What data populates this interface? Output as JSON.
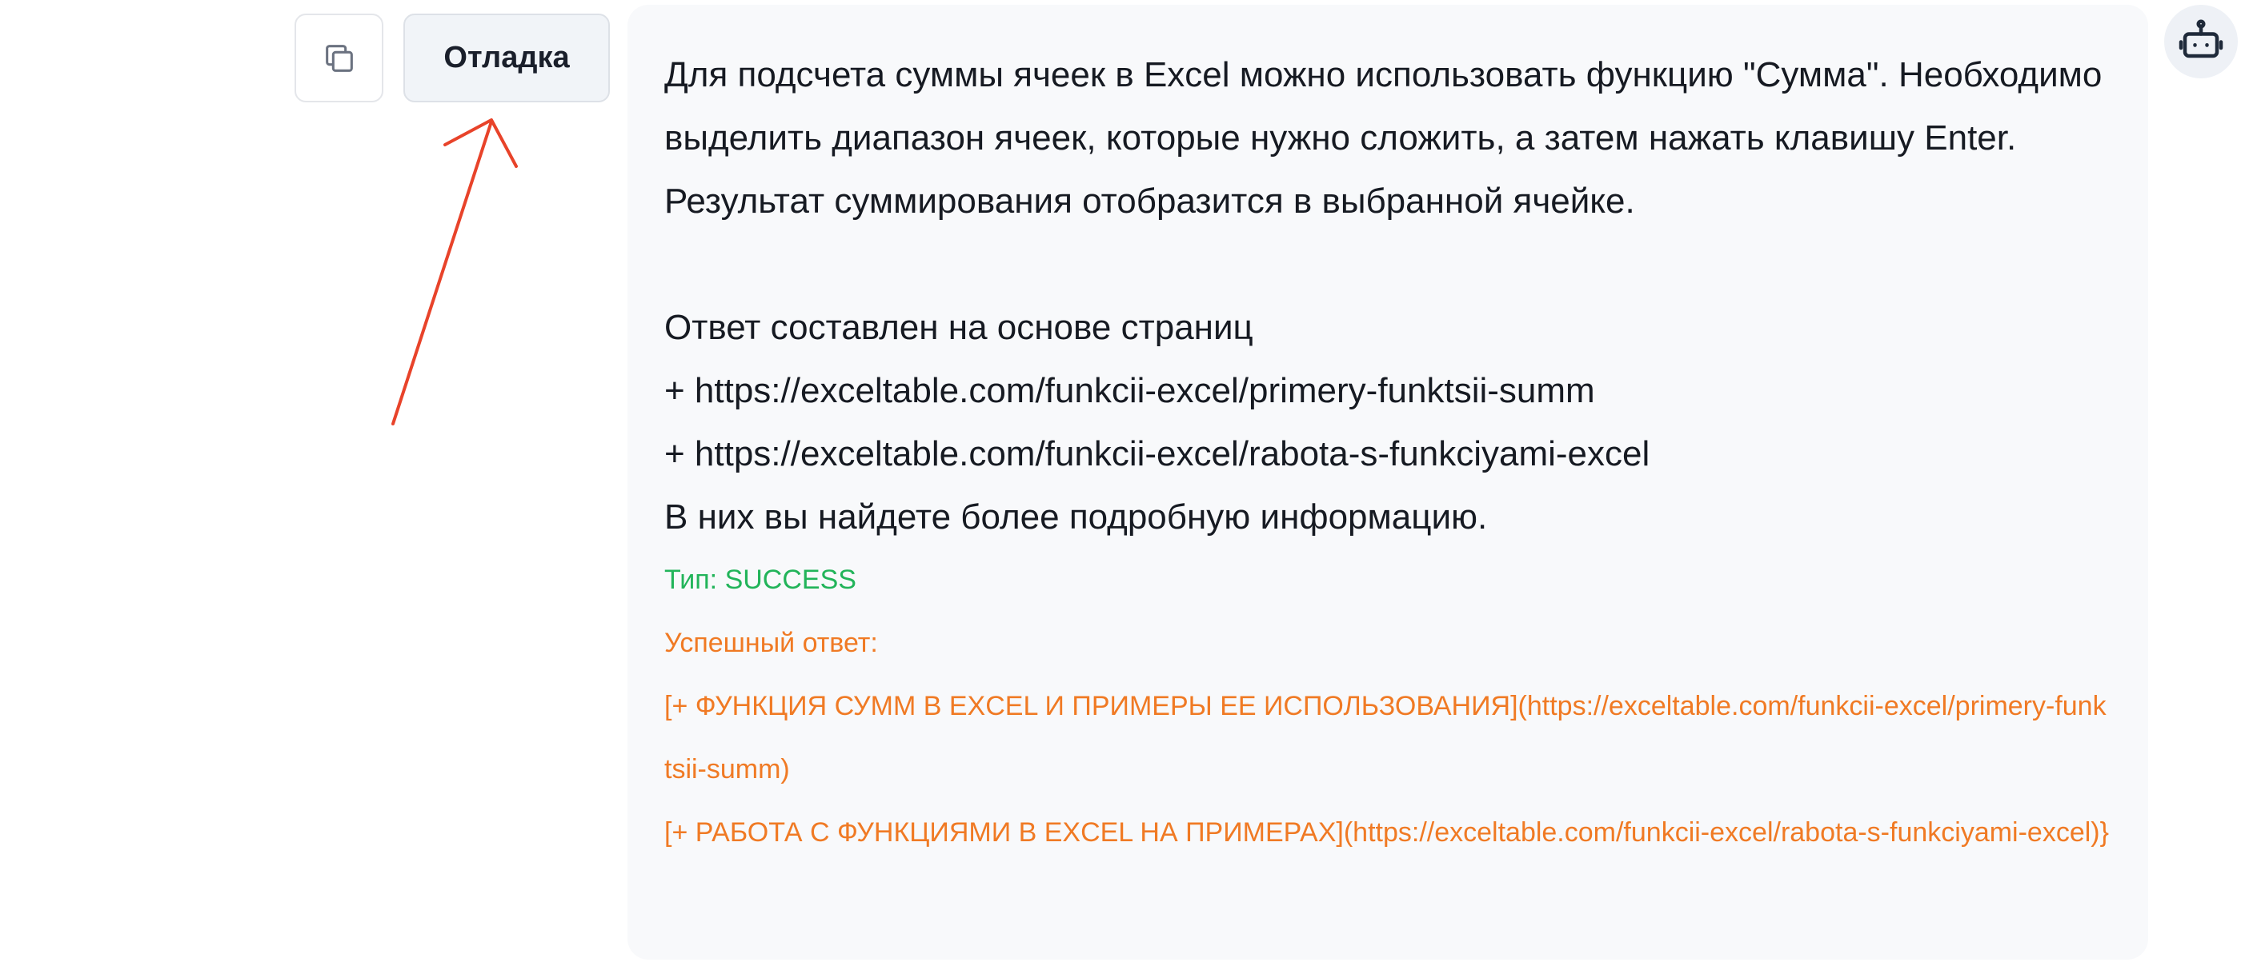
{
  "toolbar": {
    "copy_icon": "copy-icon",
    "debug_label": "Отладка"
  },
  "message": {
    "lines": [
      "Для подсчета суммы ячеек в Excel можно использовать функцию \"Сумма\". Необходимо выделить диапазон ячеек, которые нужно сложить, а затем нажать клавишу Enter. Результат суммирования отобразится в выбранной ячейке.",
      "",
      "Ответ составлен на основе страниц",
      "+ https://exceltable.com/funkcii-excel/primery-funktsii-summ",
      "+ https://exceltable.com/funkcii-excel/rabota-s-funkciyami-excel",
      "В них вы найдете более подробную информацию."
    ],
    "status": "Тип: SUCCESS",
    "success_label": "Успешный ответ:",
    "links": [
      "[+ ФУНКЦИЯ СУММ В EXCEL И ПРИМЕРЫ ЕЕ ИСПОЛЬЗОВАНИЯ](https://exceltable.com/funkcii-excel/primery-funktsii-summ)",
      "[+ РАБОТА С ФУНКЦИЯМИ В EXCEL НА ПРИМЕРАХ](https://exceltable.com/funkcii-excel/rabota-s-funkciyami-excel)}"
    ]
  },
  "avatar": {
    "icon": "robot-icon"
  },
  "colors": {
    "status_green": "#22b45a",
    "link_orange": "#f07a24",
    "arrow_red": "#e8432a",
    "bubble_bg": "#f8f9fb"
  }
}
